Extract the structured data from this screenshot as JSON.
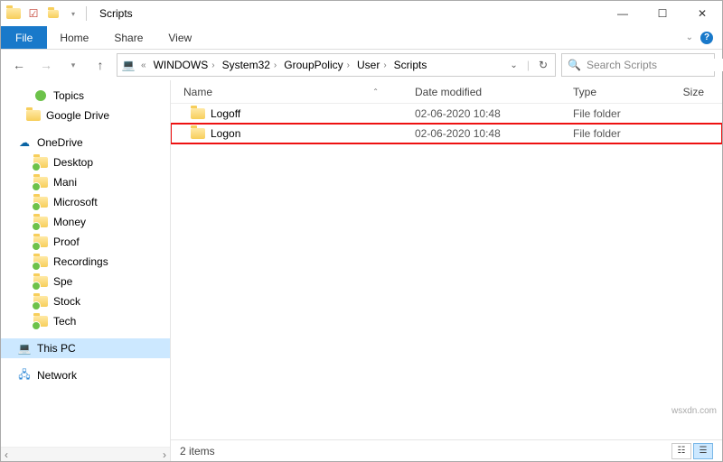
{
  "window": {
    "title": "Scripts"
  },
  "ribbon": {
    "file": "File",
    "tabs": [
      "Home",
      "Share",
      "View"
    ]
  },
  "breadcrumbs": [
    "WINDOWS",
    "System32",
    "GroupPolicy",
    "User",
    "Scripts"
  ],
  "search": {
    "placeholder": "Search Scripts"
  },
  "tree": {
    "section1": [
      {
        "label": "Topics",
        "icon": "topics"
      },
      {
        "label": "Google Drive",
        "icon": "folder"
      }
    ],
    "onedrive": {
      "label": "OneDrive",
      "icon": "cloud"
    },
    "onedrive_children": [
      {
        "label": "Desktop"
      },
      {
        "label": "Mani"
      },
      {
        "label": "Microsoft"
      },
      {
        "label": "Money"
      },
      {
        "label": "Proof"
      },
      {
        "label": "Recordings"
      },
      {
        "label": "Spe"
      },
      {
        "label": "Stock"
      },
      {
        "label": "Tech"
      }
    ],
    "this_pc": {
      "label": "This PC"
    },
    "network": {
      "label": "Network"
    }
  },
  "columns": {
    "name": "Name",
    "date": "Date modified",
    "type": "Type",
    "size": "Size"
  },
  "rows": [
    {
      "name": "Logoff",
      "date": "02-06-2020 10:48",
      "type": "File folder",
      "highlighted": false
    },
    {
      "name": "Logon",
      "date": "02-06-2020 10:48",
      "type": "File folder",
      "highlighted": true
    }
  ],
  "status": {
    "text": "2 items"
  },
  "watermark": "wsxdn.com"
}
